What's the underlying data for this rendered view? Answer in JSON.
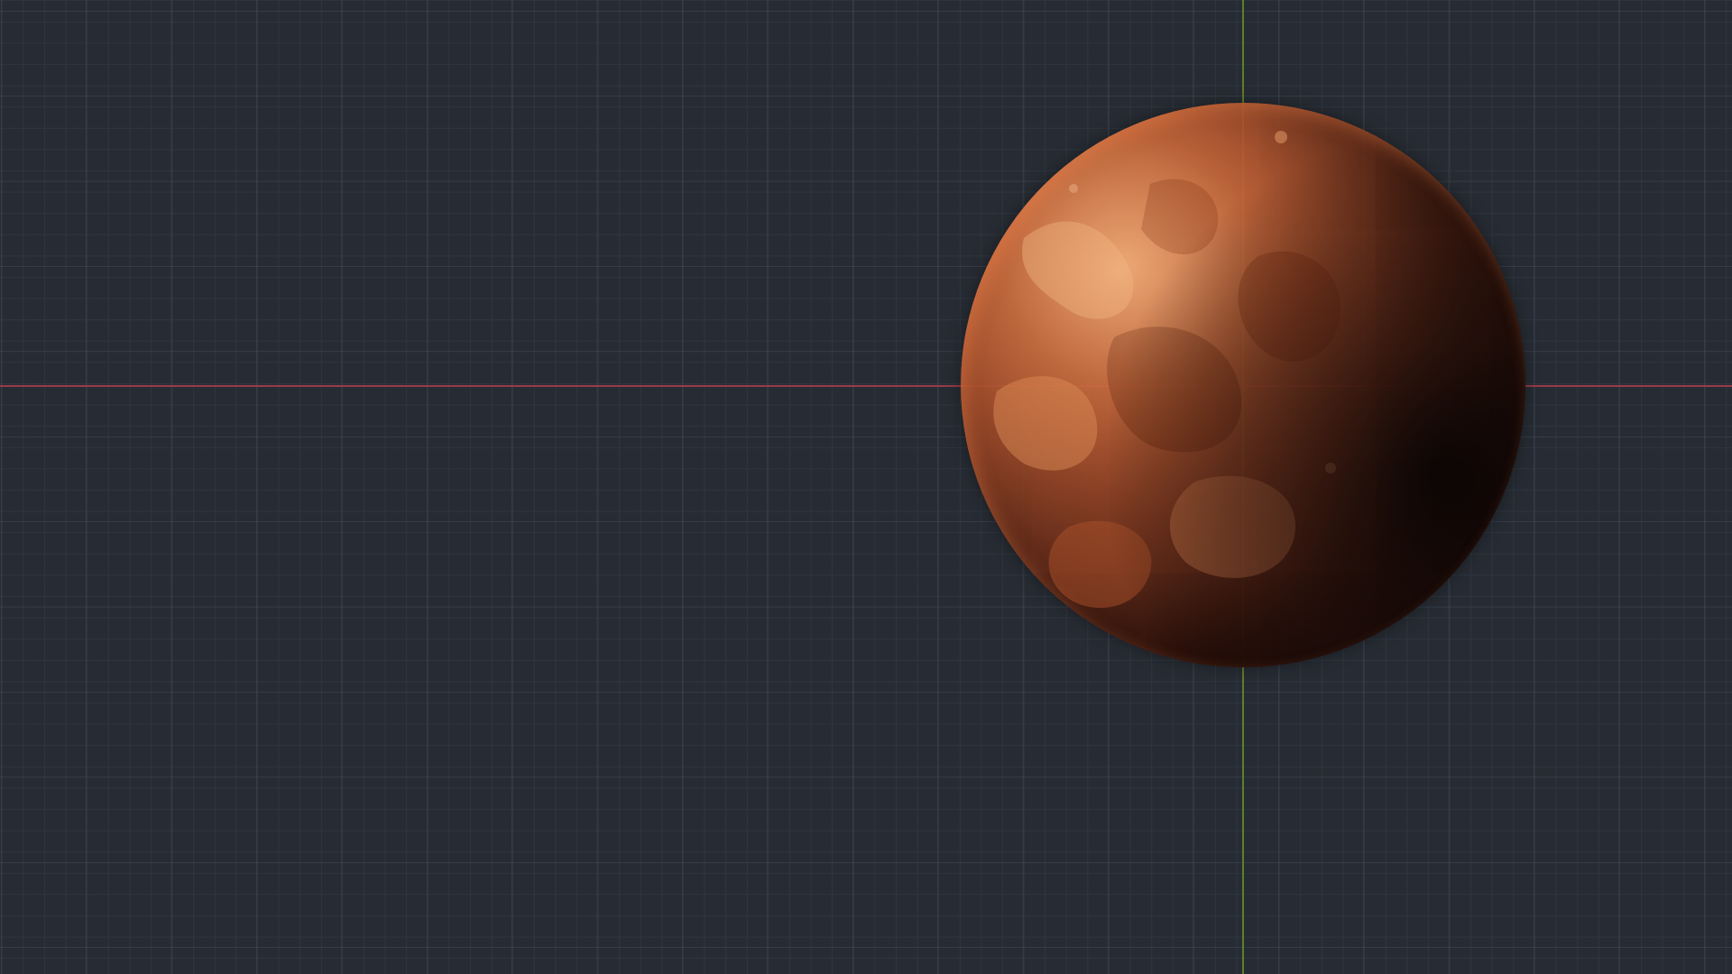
{
  "viewport": {
    "background_color": "#272c34",
    "grid_line_color": "#3a4452",
    "x_axis_color": "#9a3a48",
    "y_axis_color": "#5f7f2c"
  },
  "object": {
    "icon": "planet-sphere",
    "base_color": "#b5552c",
    "highlight_color": "#e8a070",
    "shadow_color": "#140a0a"
  }
}
